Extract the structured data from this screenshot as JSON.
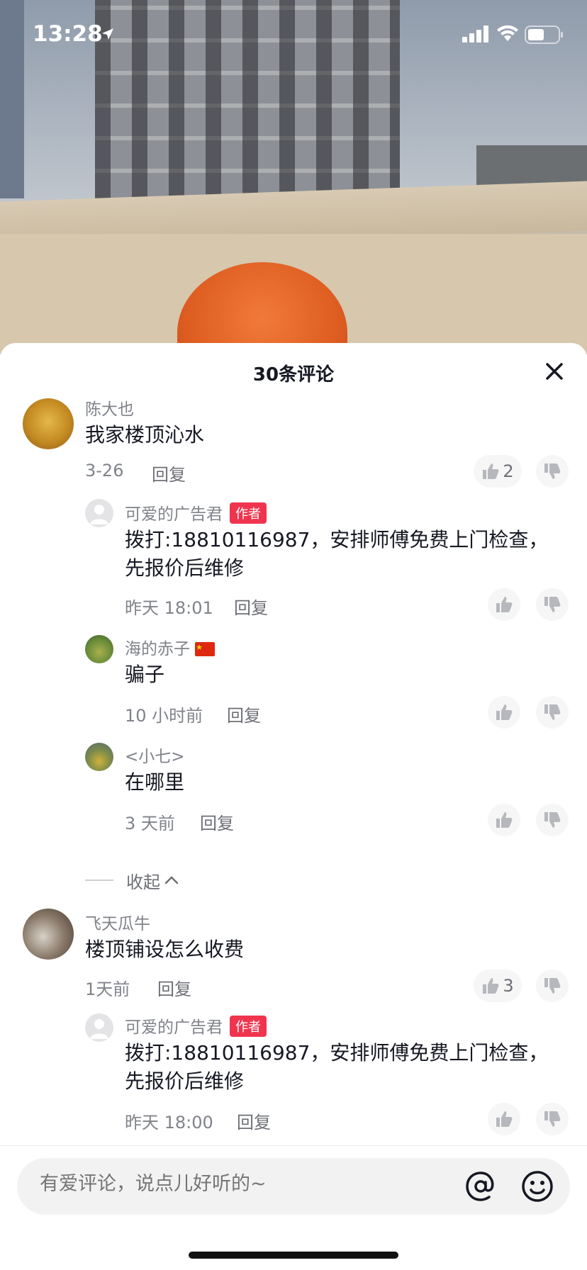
{
  "status_bar": {
    "time": "13:28"
  },
  "comments_panel": {
    "title": "30条评论",
    "collapse_label": "收起",
    "input_placeholder": "有爱评论，说点儿好听的~"
  },
  "comments": [
    {
      "author": "陈大也",
      "text": "我家楼顶沁水",
      "date": "3-26",
      "reply_label": "回复",
      "likes": "2"
    },
    {
      "author": "可爱的广告君",
      "badge": "作者",
      "text_line1": "拨打:18810116987，安排师傅免费上门检查，",
      "text_line2": "先报价后维修",
      "date": "昨天 18:01",
      "reply_label": "回复"
    },
    {
      "author": "海的赤子",
      "text": "骗子",
      "date": "10 小时前",
      "reply_label": "回复"
    },
    {
      "author": "<小七>",
      "text": "在哪里",
      "date": "3 天前",
      "reply_label": "回复"
    },
    {
      "author": "飞天瓜牛",
      "text": "楼顶铺设怎么收费",
      "date": "1天前",
      "reply_label": "回复",
      "likes": "3"
    },
    {
      "author": "可爱的广告君",
      "badge": "作者",
      "text_line1": "拨打:18810116987，安排师傅免费上门检查，",
      "text_line2": "先报价后维修",
      "date": "昨天 18:00",
      "reply_label": "回复"
    }
  ],
  "colors": {
    "badge": "#f0344e",
    "worker": "#e0622a"
  }
}
